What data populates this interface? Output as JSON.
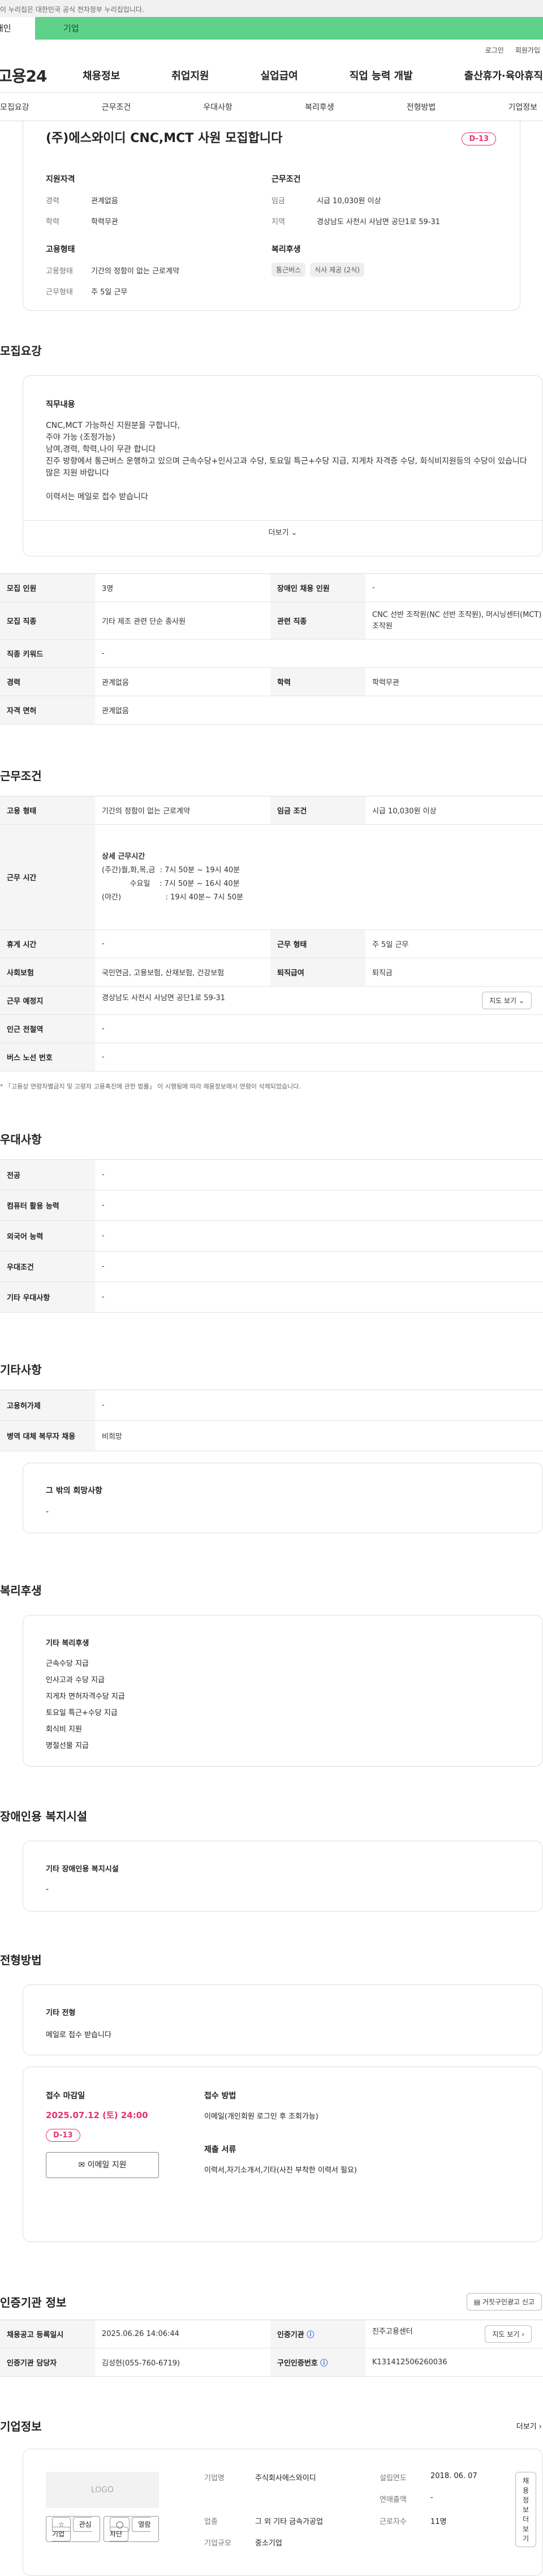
{
  "gov_banner": "이 누리집은 대한민국 공식 전자정부 누리집입니다.",
  "user_type_tabs": {
    "personal": "개인",
    "corporate": "기업"
  },
  "util_links": {
    "login": "로그인",
    "signup": "회원가입"
  },
  "logo": "고용24",
  "gnb": [
    "채용정보",
    "취업지원",
    "실업급여",
    "직업 능력 개발",
    "출산휴가·육아휴직"
  ],
  "anchor_tabs": [
    "모집요강",
    "근무조건",
    "우대사항",
    "복리후생",
    "전형방법",
    "기업정보"
  ],
  "posting": {
    "title": "(주)에스와이디 CNC,MCT 사원 모집합니다",
    "dday": "D-13",
    "qualification_heading": "지원자격",
    "career_key": "경력",
    "career_val": "관계없음",
    "education_key": "학력",
    "education_val": "학력무관",
    "employ_heading": "고용형태",
    "employ_type_key": "고용형태",
    "employ_type_val": "기간의 정함이 없는 근로계약",
    "work_type_key": "근무형태",
    "work_type_val": "주 5일 근무",
    "cond_heading": "근무조건",
    "wage_key": "임금",
    "wage_val": "시급 10,030원 이상",
    "region_key": "지역",
    "region_val": "경상남도 사천시 사남면 공단1로 59-31",
    "welfare_heading": "복리후생",
    "welfare_chips": [
      "통근버스",
      "식사 제공 (2식)"
    ]
  },
  "recruit": {
    "section_title": "모집요강",
    "detail_heading": "직무내용",
    "detail_lines": [
      "CNC,MCT 가능하신 지원분을 구합니다,",
      "주야 가능 (조정가능)",
      "남여,경력, 학력,나이 무관 합니다",
      "진주 방향에서 통근버스 운행하고 있으며 근속수당+인사고과 수당, 토요일 특근+수당 지급, 지게차 자격증 수당, 회식비지원등의 수당이 있습니다",
      "많은 지원 바랍니다",
      "",
      "이력서는 메일로 접수 받습니다"
    ],
    "more_label": "더보기",
    "rows": [
      {
        "k1": "모집 인원",
        "v1": "3명",
        "k2": "장애인 채용 인원",
        "v2": "-"
      },
      {
        "k1": "모집 직종",
        "v1": "기타 제조 관련 단순 종사원",
        "k2": "관련 직종",
        "v2": "CNC 선반 조작원(NC 선반 조작원), 머시닝센터(MCT) 조작원"
      },
      {
        "k1": "직종 키워드",
        "v1": "-"
      },
      {
        "k1": "경력",
        "v1": "관계없음",
        "k2": "학력",
        "v2": "학력무관"
      },
      {
        "k1": "자격 면허",
        "v1": "관계없음"
      }
    ]
  },
  "conditions": {
    "section_title": "근무조건",
    "employ_key": "고용 형태",
    "employ_val": "기간의 정함이 없는 근로계약",
    "wage_key": "임금 조건",
    "wage_val": "시급 10,030원 이상",
    "time_key": "근무 시간",
    "time_lines": [
      "상세 근무시간",
      "(주간)월,화,목,금  : 7시 50분 ~ 19시 40분",
      "            수요일    : 7시 50분 ~ 16시 40분",
      "(야간)                   : 19시 40분~ 7시 50분"
    ],
    "rest_key": "휴게 시간",
    "rest_val": "-",
    "worktype_key": "근무 형태",
    "worktype_val": "주 5일 근무",
    "insurance_key": "사회보험",
    "insurance_val": "국민연금, 고용보험, 산재보험, 건강보험",
    "retire_key": "퇴직급여",
    "retire_val": "퇴직금",
    "place_key": "근무 예정지",
    "place_val": "경상남도 사천시 사남면 공단1로 59-31",
    "map_btn": "지도 보기",
    "station_key": "인근 전철역",
    "station_val": "-",
    "bus_key": "버스 노선 번호",
    "bus_val": "-",
    "note": "* 「고용상 연령차별금지 및 고령자 고용촉진에 관한 법률」 이 시행됨에 따라 채용정보에서 연령이 삭제되었습니다."
  },
  "preference": {
    "section_title": "우대사항",
    "rows": [
      {
        "k": "전공",
        "v": "-"
      },
      {
        "k": "컴퓨터 활용 능력",
        "v": "-"
      },
      {
        "k": "외국어 능력",
        "v": "-"
      },
      {
        "k": "우대조건",
        "v": "-"
      },
      {
        "k": "기타 우대사항",
        "v": "-"
      }
    ]
  },
  "etc": {
    "section_title": "기타사항",
    "rows": [
      {
        "k": "고용허가제",
        "v": "-"
      },
      {
        "k": "병역 대체 복무자 채용",
        "v": "비희망"
      }
    ],
    "wish_heading": "그 밖의 희망사항",
    "wish_val": "-"
  },
  "welfare": {
    "section_title": "복리후생",
    "heading": "기타 복리후생",
    "items": [
      "근속수당 지급",
      "인사고과 수당 지급",
      "지게차 면허자격수당 지급",
      "토요일 특근+수당 지급",
      "회식비 지원",
      "명절선물 지급"
    ]
  },
  "disability": {
    "section_title": "장애인용 복지시설",
    "heading": "기타 장애인용 복지시설",
    "value": "-"
  },
  "method": {
    "section_title": "전형방법",
    "etc_heading": "기타 전형",
    "etc_val": "메일로 접수 받습니다",
    "deadline_heading": "접수 마감일",
    "deadline_val": "2025.07.12 (토) 24:00",
    "dday": "D-13",
    "mail_btn": "이메일 지원",
    "apply_method_heading": "접수 방법",
    "apply_method_val": "이메일(개인회원 로그인 후 조회가능)",
    "docs_heading": "제출 서류",
    "docs_val": "이력서,자기소개서,기타(사진 부착한 이력서 필요)"
  },
  "agency": {
    "section_title": "인증기관 정보",
    "report_btn": "거짓구인광고 신고",
    "reg_date_key": "채용공고 등록일시",
    "reg_date_val": "2025.06.26 14:06:44",
    "agency_key": "인증기관",
    "agency_val": "진주고용센터",
    "manager_key": "인증기관 담당자",
    "manager_val": "김성현(055-760-6719)",
    "no_key": "구인인증번호",
    "no_val": "K131412506260036",
    "map_btn": "지도 보기"
  },
  "company": {
    "section_title": "기업정보",
    "more_link": "더보기",
    "logo_label": "LOGO",
    "interest_btn": "관심기업",
    "block_btn": "열람차단",
    "name_key": "기업명",
    "name_val": "주식회사에스와이디",
    "founded_key": "설립연도",
    "founded_val": "2018. 06. 07",
    "sales_key": "연매출액",
    "sales_val": "-",
    "industry_key": "업종",
    "industry_val": "그 외 기타 금속가공업",
    "employees_key": "근로자수",
    "employees_val": "11명",
    "size_key": "기업규모",
    "size_val": "중소기업",
    "detail_btn": "채용정보 더보기"
  }
}
